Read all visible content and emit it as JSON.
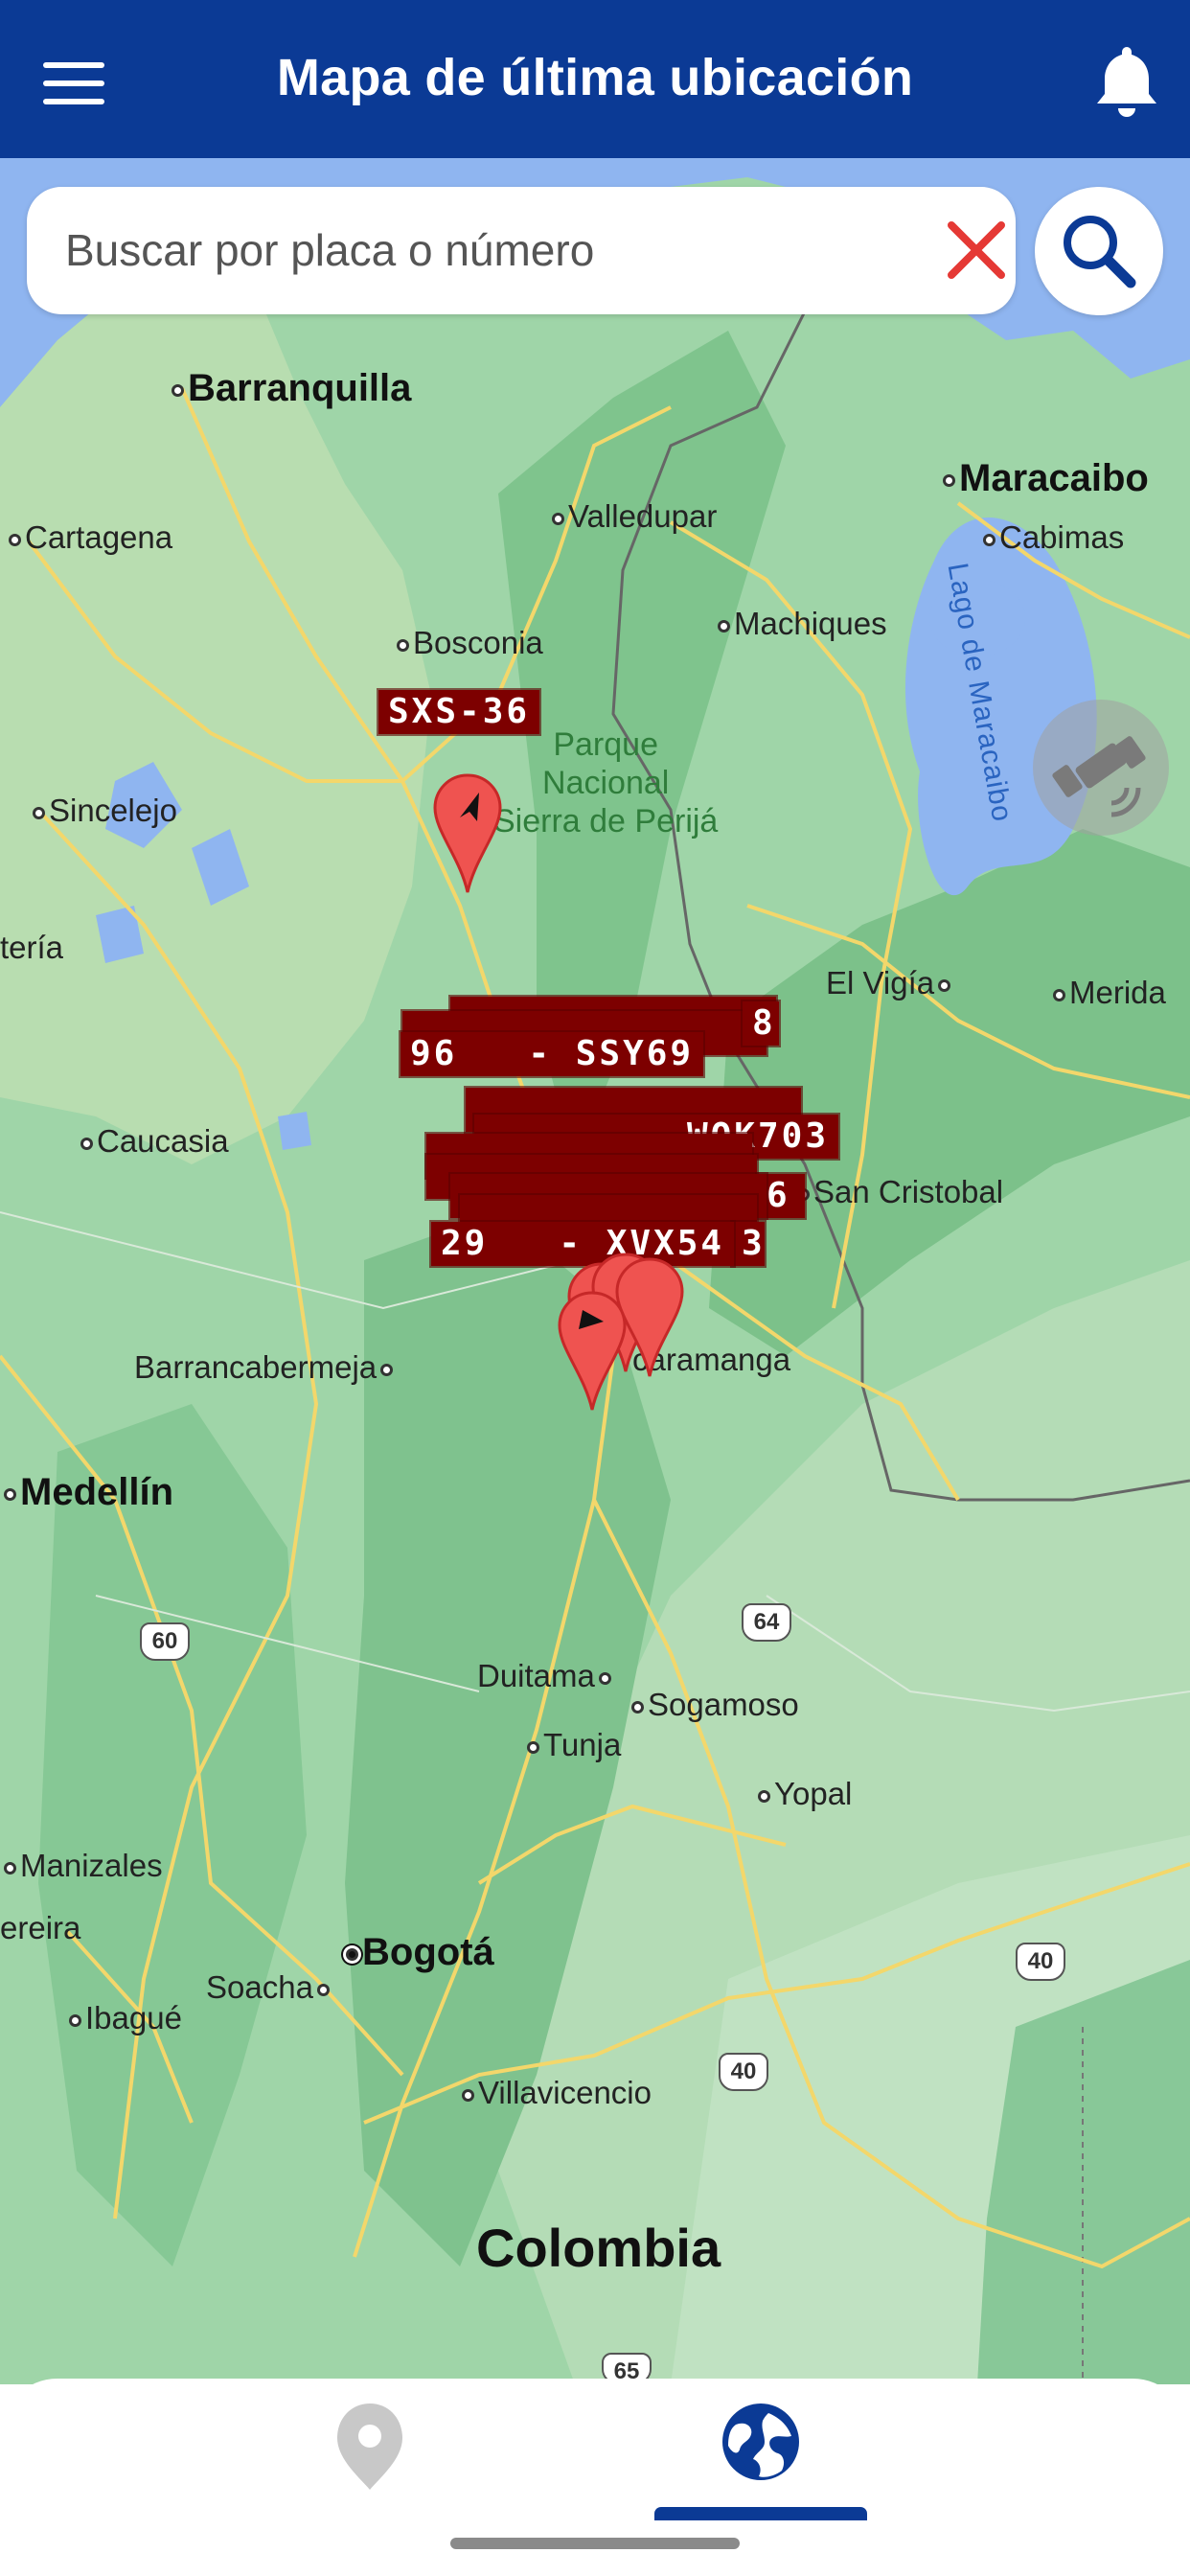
{
  "header": {
    "title": "Mapa de última ubicación",
    "menu_icon": "hamburger-menu-icon",
    "notification_icon": "bell-icon",
    "background": "#0b3a95"
  },
  "search": {
    "placeholder": "Buscar por placa o número",
    "value": "",
    "clear_icon": "close-x-icon",
    "clear_color": "#e53935",
    "search_icon": "search-icon",
    "search_color": "#0b3a95"
  },
  "map": {
    "cities": [
      "Barranquilla",
      "Maracaibo",
      "Cartagena",
      "Valledupar",
      "Cabimas",
      "Bosconia",
      "Machiques",
      "Sincelejo",
      "tería",
      "El Vigía",
      "Merida",
      "Caucasia",
      "San Cristobal",
      "Barrancabermeja",
      "caramanga",
      "Medellín",
      "Duitama",
      "Sogamoso",
      "Tunja",
      "Yopal",
      "Manizales",
      "ereira",
      "Bogotá",
      "Soacha",
      "Ibagué",
      "Villavicencio"
    ],
    "park": "Parque\nNacional\nSierra de Perijá",
    "lake": "Lago de Maracaibo",
    "country": "Colombia",
    "routes": [
      "60",
      "64",
      "40",
      "40",
      "65"
    ]
  },
  "vehicles": {
    "labels": [
      "SXS-36",
      "96   - SSY69",
      "29   - XVX54",
      "WOK703",
      "8",
      "6",
      "3"
    ],
    "plate_color": "#7d0000",
    "marker_color": "#ef5350"
  },
  "gps_button": {
    "icon": "satellite-icon"
  },
  "bottom_nav": {
    "items": [
      {
        "name": "location",
        "icon": "map-pin-icon",
        "active": false
      },
      {
        "name": "globe",
        "icon": "globe-icon",
        "active": true
      }
    ],
    "active_color": "#0b3a95",
    "inactive_color": "#c8c8c8"
  }
}
